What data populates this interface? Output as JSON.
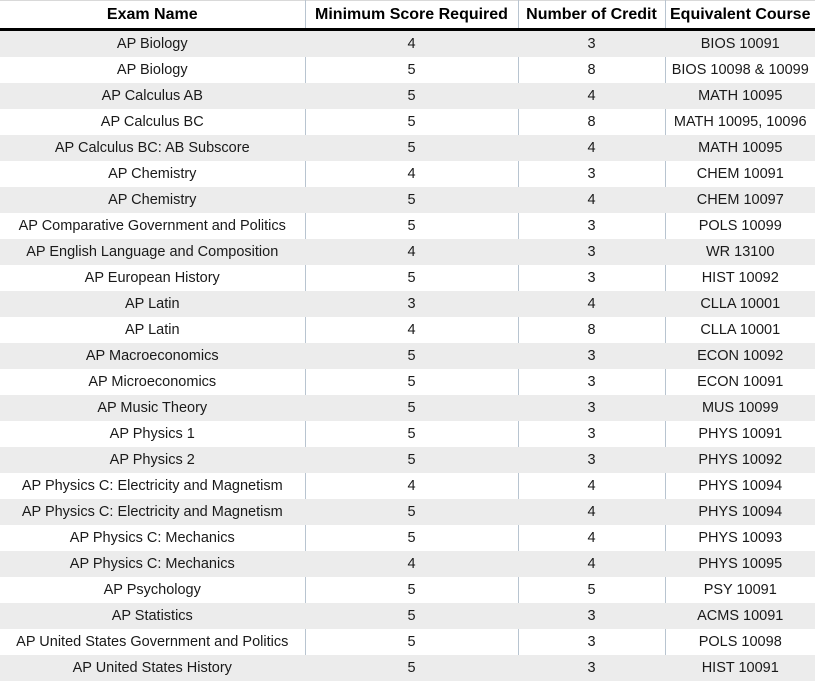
{
  "table": {
    "columns": [
      "Exam Name",
      "Minimum Score Required",
      "Number of Credit",
      "Equivalent Course"
    ],
    "rows": [
      [
        "AP Biology",
        "4",
        "3",
        "BIOS 10091"
      ],
      [
        "AP Biology",
        "5",
        "8",
        "BIOS 10098 & 10099"
      ],
      [
        "AP Calculus AB",
        "5",
        "4",
        "MATH 10095"
      ],
      [
        "AP Calculus BC",
        "5",
        "8",
        "MATH 10095, 10096"
      ],
      [
        "AP Calculus BC: AB Subscore",
        "5",
        "4",
        "MATH 10095"
      ],
      [
        "AP Chemistry",
        "4",
        "3",
        "CHEM 10091"
      ],
      [
        "AP Chemistry",
        "5",
        "4",
        "CHEM 10097"
      ],
      [
        "AP Comparative Government and Politics",
        "5",
        "3",
        "POLS 10099"
      ],
      [
        "AP English Language and Composition",
        "4",
        "3",
        "WR 13100"
      ],
      [
        "AP European History",
        "5",
        "3",
        "HIST 10092"
      ],
      [
        "AP Latin",
        "3",
        "4",
        "CLLA 10001"
      ],
      [
        "AP Latin",
        "4",
        "8",
        "CLLA 10001"
      ],
      [
        "AP Macroeconomics",
        "5",
        "3",
        "ECON 10092"
      ],
      [
        "AP Microeconomics",
        "5",
        "3",
        "ECON 10091"
      ],
      [
        "AP Music Theory",
        "5",
        "3",
        "MUS 10099"
      ],
      [
        "AP Physics 1",
        "5",
        "3",
        "PHYS 10091"
      ],
      [
        "AP Physics 2",
        "5",
        "3",
        "PHYS 10092"
      ],
      [
        "AP Physics C: Electricity and Magnetism",
        "4",
        "4",
        "PHYS 10094"
      ],
      [
        "AP Physics C: Electricity and Magnetism",
        "5",
        "4",
        "PHYS 10094"
      ],
      [
        "AP Physics C: Mechanics",
        "5",
        "4",
        "PHYS 10093"
      ],
      [
        "AP Physics C: Mechanics",
        "4",
        "4",
        "PHYS 10095"
      ],
      [
        "AP Psychology",
        "5",
        "5",
        "PSY 10091"
      ],
      [
        "AP Statistics",
        "5",
        "3",
        "ACMS 10091"
      ],
      [
        "AP United States Government and Politics",
        "5",
        "3",
        "POLS 10098"
      ],
      [
        "AP United States History",
        "5",
        "3",
        "HIST 10091"
      ]
    ]
  },
  "colors": {
    "row_shade": "#ececec",
    "row_plain": "#ffffff",
    "divider": "#b8c4d0",
    "header_rule": "#000000",
    "text": "#1a1a1a"
  }
}
